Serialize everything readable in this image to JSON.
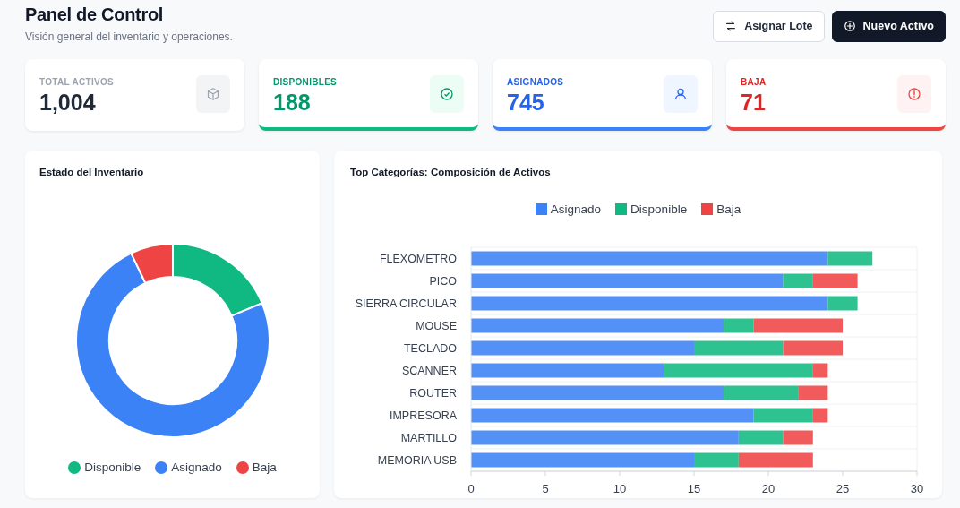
{
  "header": {
    "title": "Panel de Control",
    "subtitle": "Visión general del inventario y operaciones.",
    "buttons": [
      {
        "label": "Asignar Lote",
        "kind": "secondary"
      },
      {
        "label": "Nuevo Activo",
        "kind": "primary"
      }
    ]
  },
  "stats": [
    {
      "label": "TOTAL ACTIVOS",
      "value": "1,004",
      "kind": "neutral"
    },
    {
      "label": "DISPONIBLES",
      "value": "188",
      "kind": "success"
    },
    {
      "label": "ASIGNADOS",
      "value": "745",
      "kind": "primary"
    },
    {
      "label": "BAJA",
      "value": "71",
      "kind": "danger"
    }
  ],
  "inventory_panel": {
    "chart_data": {
      "type": "donut",
      "title": "Estado del Inventario",
      "categories": [
        "Disponible",
        "Asignado",
        "Baja"
      ],
      "values": [
        18.7,
        74.2,
        7.1
      ]
    }
  },
  "categories_panel": {
    "chart_data": {
      "type": "bar",
      "orientation": "horizontal",
      "stacked": true,
      "title": "Top Categorías: Composición de Activos",
      "categories": [
        "FLEXOMETRO",
        "PICO",
        "SIERRA CIRCULAR",
        "MOUSE",
        "TECLADO",
        "SCANNER",
        "ROUTER",
        "IMPRESORA",
        "MARTILLO",
        "MEMORIA USB"
      ],
      "xlim": [
        0,
        30
      ],
      "xticks": [
        0,
        5,
        10,
        15,
        20,
        25,
        30
      ],
      "series": [
        {
          "name": "Asignado",
          "color": "#3b82f6",
          "values": [
            24,
            21,
            24,
            17,
            15,
            13,
            17,
            19,
            18,
            15
          ]
        },
        {
          "name": "Disponible",
          "color": "#10b981",
          "values": [
            3,
            2,
            2,
            2,
            6,
            10,
            5,
            4,
            3,
            3
          ]
        },
        {
          "name": "Baja",
          "color": "#ef4444",
          "values": [
            0,
            3,
            0,
            6,
            4,
            1,
            2,
            1,
            2,
            5
          ]
        }
      ]
    }
  }
}
